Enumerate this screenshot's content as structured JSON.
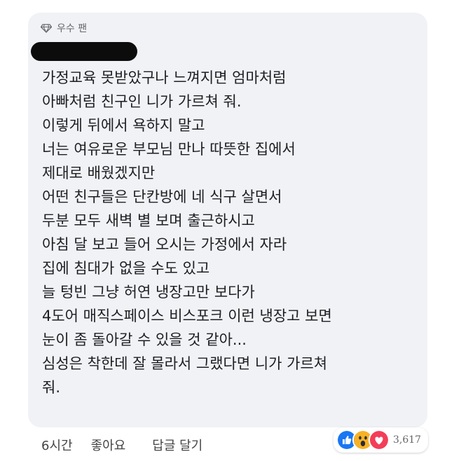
{
  "badge": {
    "label": "우수 팬"
  },
  "comment": {
    "lines": [
      "가정교육 못받았구나 느껴지면 엄마처럼",
      "아빠처럼 친구인 니가 가르쳐 줘.",
      "이렇게 뒤에서 욕하지 말고",
      "너는 여유로운 부모님 만나 따뜻한 집에서",
      "제대로 배웠겠지만",
      "어떤 친구들은 단칸방에 네 식구 살면서",
      "두분 모두 새벽 별 보며 출근하시고",
      "아침 달 보고 들어 오시는 가정에서 자라",
      "집에 침대가 없을 수도 있고",
      "늘 텅빈 그냥 허연 냉장고만 보다가",
      "4도어 매직스페이스 비스포크 이런 냉장고 보면",
      "눈이 좀 돌아갈 수 있을 것 같아...",
      "심성은 착한데 잘 몰라서 그랬다면 니가 가르쳐",
      "줘."
    ]
  },
  "actions": {
    "time": "6시간",
    "like": "좋아요",
    "reply": "답글 달기"
  },
  "reactions": {
    "icons": [
      "like-icon",
      "wow-icon",
      "love-icon"
    ],
    "count": "3,617",
    "colors": {
      "like": "#1877f2",
      "wow": "#f7b125",
      "love": "#f33e58"
    }
  }
}
